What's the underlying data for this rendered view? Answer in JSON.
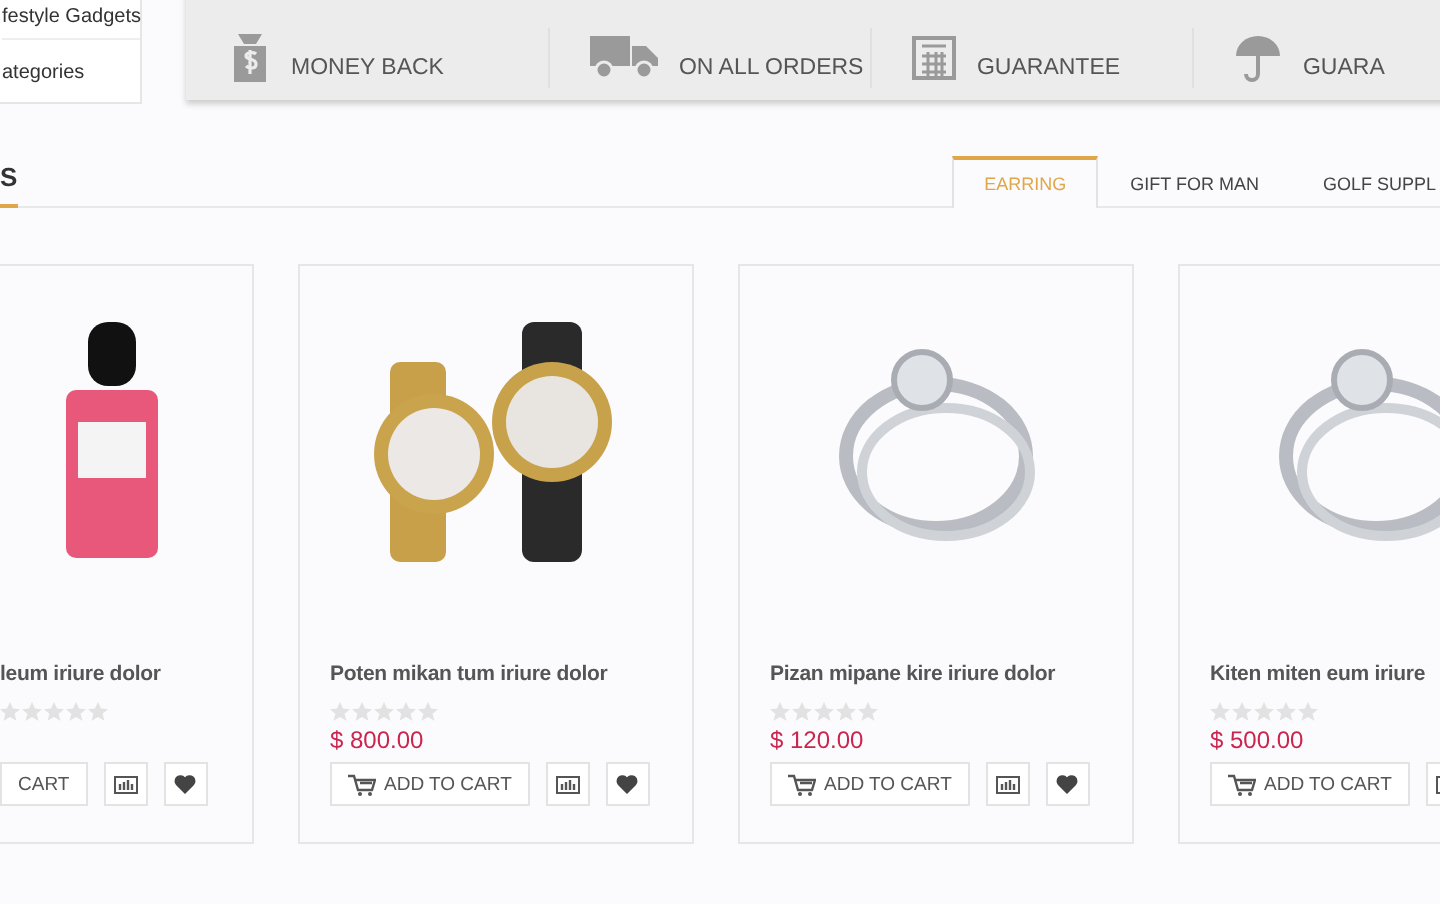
{
  "sidebar": {
    "items": [
      {
        "label": "festyle Gadgets"
      },
      {
        "label": "ategories"
      }
    ]
  },
  "features": [
    {
      "kind": "money",
      "text": "MONEY BACK"
    },
    {
      "kind": "truck",
      "text": "ON ALL ORDERS"
    },
    {
      "kind": "calculator",
      "text": "GUARANTEE"
    },
    {
      "kind": "umbrella",
      "text": "GUARA"
    }
  ],
  "section": {
    "title": "S"
  },
  "tabs": [
    {
      "label": "EARRING",
      "selected": true
    },
    {
      "label": "GIFT FOR MAN",
      "selected": false
    },
    {
      "label": "GOLF SUPPL",
      "selected": false
    }
  ],
  "products": [
    {
      "kind": "perfume",
      "name": "leum iriure dolor",
      "stars": 0,
      "cart_label": "CART"
    },
    {
      "kind": "watch",
      "name": "Poten mikan tum iriure dolor",
      "stars": 0,
      "price": "$ 800.00",
      "cart_label": "ADD TO CART"
    },
    {
      "kind": "ring",
      "name": "Pizan mipane kire iriure dolor",
      "stars": 0,
      "price": "$ 120.00",
      "cart_label": "ADD TO CART"
    },
    {
      "kind": "ring",
      "name": "Kiten miten eum iriure",
      "stars": 0,
      "price": "$ 500.00",
      "cart_label": "ADD TO CART"
    }
  ]
}
